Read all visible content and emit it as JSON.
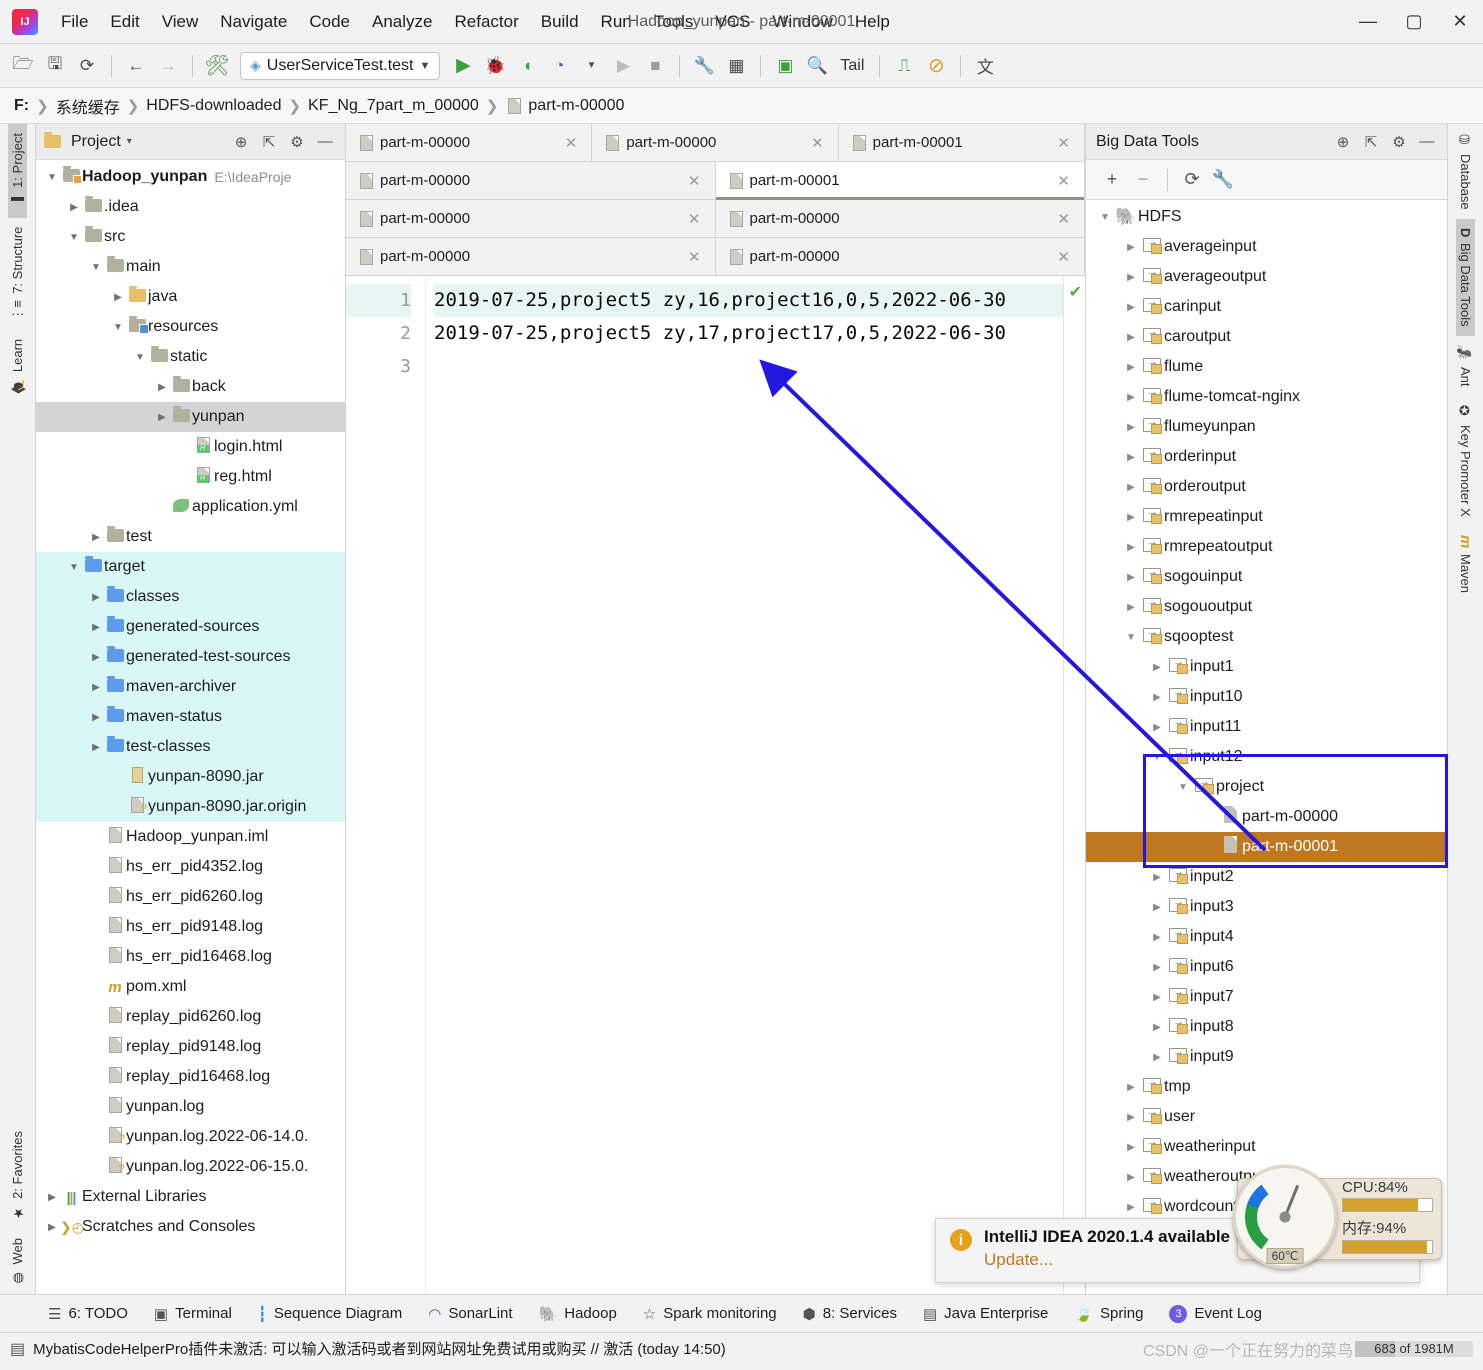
{
  "window": {
    "title": "Hadoop_yunpan - part-m-00001",
    "minimize": "—",
    "maximize": "▢",
    "close": "✕"
  },
  "menubar": {
    "items": [
      "File",
      "Edit",
      "View",
      "Navigate",
      "Code",
      "Analyze",
      "Refactor",
      "Build",
      "Run",
      "Tools",
      "VCS",
      "Window",
      "Help"
    ]
  },
  "toolbar": {
    "open_icon": "open-folder-icon",
    "save_icon": "save-icon",
    "sync_icon": "sync-icon",
    "back_icon": "←",
    "forward_icon": "→",
    "hammer_icon": "build-icon",
    "run_config": "UserServiceTest.test",
    "run_icon": "▶",
    "debug_icon": "debug-icon",
    "coverage_icon": "coverage-icon",
    "profile_icon": "profile-icon",
    "tail_label": "Tail",
    "search_icon": "🔍",
    "wrench_icon": "wrench-icon",
    "layout_icon": "layout-icon",
    "console_icon": "console-icon",
    "monitor_icon": "monitor-icon",
    "forbidden_icon": "⊘",
    "translate_icon": "translate-icon"
  },
  "breadcrumb": {
    "items": [
      "F:",
      "系统缓存",
      "HDFS-downloaded",
      "KF_Ng_7part_m_00000",
      "part-m-00000"
    ],
    "separator": "❯"
  },
  "left_strip": {
    "tabs": [
      {
        "label": "1: Project",
        "icon": "project-icon",
        "active": true
      },
      {
        "label": "7: Structure",
        "icon": "structure-icon",
        "active": false
      },
      {
        "label": "Learn",
        "icon": "graduation-cap-icon",
        "active": false
      }
    ],
    "bottom_tabs": [
      {
        "label": "2: Favorites",
        "icon": "star-icon"
      },
      {
        "label": "Web",
        "icon": "web-icon"
      }
    ]
  },
  "right_strip": {
    "tabs": [
      {
        "label": "Database",
        "icon": "database-icon",
        "active": false
      },
      {
        "label": "Big Data Tools",
        "icon": "big-data-icon",
        "active": true
      },
      {
        "label": "Ant",
        "icon": "ant-icon",
        "active": false
      },
      {
        "label": "Key Promoter X",
        "icon": "key-promoter-icon",
        "active": false
      },
      {
        "label": "Maven",
        "icon": "maven-icon",
        "active": false
      }
    ]
  },
  "project_panel": {
    "title": "Project",
    "title_caret": "▾",
    "icons": [
      "target-icon",
      "collapse-all-icon",
      "gear-icon",
      "hide-icon"
    ],
    "tree": [
      {
        "indent": 0,
        "arrow": "▼",
        "icon": "folder-src",
        "label": "Hadoop_yunpan",
        "bold": true,
        "suffix": "E:\\IdeaProje",
        "state": "none"
      },
      {
        "indent": 1,
        "arrow": "▶",
        "icon": "folder",
        "label": ".idea",
        "state": "none"
      },
      {
        "indent": 1,
        "arrow": "▼",
        "icon": "folder",
        "label": "src",
        "state": "none"
      },
      {
        "indent": 2,
        "arrow": "▼",
        "icon": "folder",
        "label": "main",
        "state": "none"
      },
      {
        "indent": 3,
        "arrow": "▶",
        "icon": "folder-yellow",
        "label": "java",
        "state": "none"
      },
      {
        "indent": 3,
        "arrow": "▼",
        "icon": "folder-res",
        "label": "resources",
        "state": "none"
      },
      {
        "indent": 4,
        "arrow": "▼",
        "icon": "folder",
        "label": "static",
        "state": "none"
      },
      {
        "indent": 5,
        "arrow": "▶",
        "icon": "folder",
        "label": "back",
        "state": "none"
      },
      {
        "indent": 5,
        "arrow": "▶",
        "icon": "folder",
        "label": "yunpan",
        "state": "sel-gray"
      },
      {
        "indent": 6,
        "arrow": "",
        "icon": "html-file",
        "label": "login.html",
        "state": "none"
      },
      {
        "indent": 6,
        "arrow": "",
        "icon": "html-file",
        "label": "reg.html",
        "state": "none"
      },
      {
        "indent": 5,
        "arrow": "",
        "icon": "yml-file",
        "label": "application.yml",
        "state": "none"
      },
      {
        "indent": 2,
        "arrow": "▶",
        "icon": "folder",
        "label": "test",
        "state": "none"
      },
      {
        "indent": 1,
        "arrow": "▼",
        "icon": "folder-blue",
        "label": "target",
        "state": "hl-cyan"
      },
      {
        "indent": 2,
        "arrow": "▶",
        "icon": "folder-blue",
        "label": "classes",
        "state": "hl-cyan"
      },
      {
        "indent": 2,
        "arrow": "▶",
        "icon": "folder-blue",
        "label": "generated-sources",
        "state": "hl-cyan"
      },
      {
        "indent": 2,
        "arrow": "▶",
        "icon": "folder-blue",
        "label": "generated-test-sources",
        "state": "hl-cyan"
      },
      {
        "indent": 2,
        "arrow": "▶",
        "icon": "folder-blue",
        "label": "maven-archiver",
        "state": "hl-cyan"
      },
      {
        "indent": 2,
        "arrow": "▶",
        "icon": "folder-blue",
        "label": "maven-status",
        "state": "hl-cyan"
      },
      {
        "indent": 2,
        "arrow": "▶",
        "icon": "folder-blue",
        "label": "test-classes",
        "state": "hl-cyan"
      },
      {
        "indent": 3,
        "arrow": "",
        "icon": "jar-file",
        "label": "yunpan-8090.jar",
        "state": "hl-cyan"
      },
      {
        "indent": 3,
        "arrow": "",
        "icon": "unknown-file",
        "label": "yunpan-8090.jar.origin",
        "state": "hl-cyan"
      },
      {
        "indent": 2,
        "arrow": "",
        "icon": "iml-file",
        "label": "Hadoop_yunpan.iml",
        "state": "none"
      },
      {
        "indent": 2,
        "arrow": "",
        "icon": "log-file",
        "label": "hs_err_pid4352.log",
        "state": "none"
      },
      {
        "indent": 2,
        "arrow": "",
        "icon": "log-file",
        "label": "hs_err_pid6260.log",
        "state": "none"
      },
      {
        "indent": 2,
        "arrow": "",
        "icon": "log-file",
        "label": "hs_err_pid9148.log",
        "state": "none"
      },
      {
        "indent": 2,
        "arrow": "",
        "icon": "log-file",
        "label": "hs_err_pid16468.log",
        "state": "none"
      },
      {
        "indent": 2,
        "arrow": "",
        "icon": "maven-file",
        "label": "pom.xml",
        "state": "none"
      },
      {
        "indent": 2,
        "arrow": "",
        "icon": "log-file",
        "label": "replay_pid6260.log",
        "state": "none"
      },
      {
        "indent": 2,
        "arrow": "",
        "icon": "log-file",
        "label": "replay_pid9148.log",
        "state": "none"
      },
      {
        "indent": 2,
        "arrow": "",
        "icon": "log-file",
        "label": "replay_pid16468.log",
        "state": "none"
      },
      {
        "indent": 2,
        "arrow": "",
        "icon": "log-file",
        "label": "yunpan.log",
        "state": "none"
      },
      {
        "indent": 2,
        "arrow": "",
        "icon": "unknown-file",
        "label": "yunpan.log.2022-06-14.0.",
        "state": "none"
      },
      {
        "indent": 2,
        "arrow": "",
        "icon": "unknown-file",
        "label": "yunpan.log.2022-06-15.0.",
        "state": "none"
      },
      {
        "indent": 0,
        "arrow": "▶",
        "icon": "library-icon",
        "label": "External Libraries",
        "state": "none"
      },
      {
        "indent": 0,
        "arrow": "▶",
        "icon": "scratch-icon",
        "label": "Scratches and Consoles",
        "state": "none"
      }
    ]
  },
  "editor": {
    "tab_rows": [
      [
        {
          "label": "part-m-00000",
          "active": false,
          "close": "✕"
        },
        {
          "label": "part-m-00000",
          "active": false,
          "close": "✕"
        },
        {
          "label": "part-m-00001",
          "active": false,
          "close": "✕"
        }
      ],
      [
        {
          "label": "part-m-00000",
          "active": false,
          "close": "✕"
        },
        {
          "label": "part-m-00001",
          "active": true,
          "close": "✕"
        }
      ],
      [
        {
          "label": "part-m-00000",
          "active": false,
          "close": "✕"
        },
        {
          "label": "part-m-00000",
          "active": false,
          "close": "✕"
        }
      ],
      [
        {
          "label": "part-m-00000",
          "active": false,
          "close": "✕"
        },
        {
          "label": "part-m-00000",
          "active": false,
          "close": "✕"
        }
      ]
    ],
    "line_numbers": [
      "1",
      "2",
      "3"
    ],
    "lines": [
      "2019-07-25,project5 zy,16,project16,0,5,2022-06-30",
      "2019-07-25,project5 zy,17,project17,0,5,2022-06-30",
      ""
    ],
    "inspection_mark": "✔"
  },
  "big_data_tools": {
    "title": "Big Data Tools",
    "header_icons": [
      "target-icon",
      "collapse-all-icon",
      "gear-icon",
      "hide-icon"
    ],
    "toolbar_icons": [
      "add-icon",
      "remove-icon",
      "refresh-icon",
      "wrench-icon"
    ],
    "tree": [
      {
        "indent": 0,
        "arrow": "▼",
        "icon": "hadoop-icon",
        "label": "HDFS",
        "state": "none"
      },
      {
        "indent": 1,
        "arrow": "▶",
        "icon": "hdfs-folder",
        "label": "averageinput",
        "state": "none"
      },
      {
        "indent": 1,
        "arrow": "▶",
        "icon": "hdfs-folder",
        "label": "averageoutput",
        "state": "none"
      },
      {
        "indent": 1,
        "arrow": "▶",
        "icon": "hdfs-folder",
        "label": "carinput",
        "state": "none"
      },
      {
        "indent": 1,
        "arrow": "▶",
        "icon": "hdfs-folder",
        "label": "caroutput",
        "state": "none"
      },
      {
        "indent": 1,
        "arrow": "▶",
        "icon": "hdfs-folder",
        "label": "flume",
        "state": "none"
      },
      {
        "indent": 1,
        "arrow": "▶",
        "icon": "hdfs-folder",
        "label": "flume-tomcat-nginx",
        "state": "none"
      },
      {
        "indent": 1,
        "arrow": "▶",
        "icon": "hdfs-folder",
        "label": "flumeyunpan",
        "state": "none"
      },
      {
        "indent": 1,
        "arrow": "▶",
        "icon": "hdfs-folder",
        "label": "orderinput",
        "state": "none"
      },
      {
        "indent": 1,
        "arrow": "▶",
        "icon": "hdfs-folder",
        "label": "orderoutput",
        "state": "none"
      },
      {
        "indent": 1,
        "arrow": "▶",
        "icon": "hdfs-folder",
        "label": "rmrepeatinput",
        "state": "none"
      },
      {
        "indent": 1,
        "arrow": "▶",
        "icon": "hdfs-folder",
        "label": "rmrepeatoutput",
        "state": "none"
      },
      {
        "indent": 1,
        "arrow": "▶",
        "icon": "hdfs-folder",
        "label": "sogouinput",
        "state": "none"
      },
      {
        "indent": 1,
        "arrow": "▶",
        "icon": "hdfs-folder",
        "label": "sogououtput",
        "state": "none"
      },
      {
        "indent": 1,
        "arrow": "▼",
        "icon": "hdfs-folder",
        "label": "sqooptest",
        "state": "none"
      },
      {
        "indent": 2,
        "arrow": "▶",
        "icon": "hdfs-folder",
        "label": "input1",
        "state": "none"
      },
      {
        "indent": 2,
        "arrow": "▶",
        "icon": "hdfs-folder",
        "label": "input10",
        "state": "none"
      },
      {
        "indent": 2,
        "arrow": "▶",
        "icon": "hdfs-folder",
        "label": "input11",
        "state": "none"
      },
      {
        "indent": 2,
        "arrow": "▼",
        "icon": "hdfs-folder",
        "label": "input12",
        "state": "none"
      },
      {
        "indent": 3,
        "arrow": "▼",
        "icon": "hdfs-folder",
        "label": "project",
        "state": "none"
      },
      {
        "indent": 4,
        "arrow": "",
        "icon": "plain-file",
        "label": "part-m-00000",
        "state": "none"
      },
      {
        "indent": 4,
        "arrow": "",
        "icon": "plain-file",
        "label": "part-m-00001",
        "state": "selected"
      },
      {
        "indent": 2,
        "arrow": "▶",
        "icon": "hdfs-folder",
        "label": "input2",
        "state": "none"
      },
      {
        "indent": 2,
        "arrow": "▶",
        "icon": "hdfs-folder",
        "label": "input3",
        "state": "none"
      },
      {
        "indent": 2,
        "arrow": "▶",
        "icon": "hdfs-folder",
        "label": "input4",
        "state": "none"
      },
      {
        "indent": 2,
        "arrow": "▶",
        "icon": "hdfs-folder",
        "label": "input6",
        "state": "none"
      },
      {
        "indent": 2,
        "arrow": "▶",
        "icon": "hdfs-folder",
        "label": "input7",
        "state": "none"
      },
      {
        "indent": 2,
        "arrow": "▶",
        "icon": "hdfs-folder",
        "label": "input8",
        "state": "none"
      },
      {
        "indent": 2,
        "arrow": "▶",
        "icon": "hdfs-folder",
        "label": "input9",
        "state": "none"
      },
      {
        "indent": 1,
        "arrow": "▶",
        "icon": "hdfs-folder",
        "label": "tmp",
        "state": "none"
      },
      {
        "indent": 1,
        "arrow": "▶",
        "icon": "hdfs-folder",
        "label": "user",
        "state": "none"
      },
      {
        "indent": 1,
        "arrow": "▶",
        "icon": "hdfs-folder",
        "label": "weatherinput",
        "state": "none"
      },
      {
        "indent": 1,
        "arrow": "▶",
        "icon": "hdfs-folder",
        "label": "weatheroutput",
        "state": "none"
      },
      {
        "indent": 1,
        "arrow": "▶",
        "icon": "hdfs-folder",
        "label": "wordcount",
        "state": "none"
      }
    ]
  },
  "annotation": {
    "highlight_color": "#2418e0",
    "selection_color": "#c07820"
  },
  "notification": {
    "icon": "info-icon",
    "title": "IntelliJ IDEA 2020.1.4 available",
    "link": "Update..."
  },
  "cpu_widget": {
    "cpu_label": "CPU:84%",
    "cpu_percent": 84,
    "mem_label": "内存:94%",
    "mem_percent": 94,
    "temperature": "60℃"
  },
  "bottom_bar": {
    "items": [
      {
        "label": "6: TODO",
        "icon": "todo-icon"
      },
      {
        "label": "Terminal",
        "icon": "terminal-icon"
      },
      {
        "label": "Sequence Diagram",
        "icon": "sequence-diagram-icon"
      },
      {
        "label": "SonarLint",
        "icon": "sonarlint-icon"
      },
      {
        "label": "Hadoop",
        "icon": "hadoop-icon"
      },
      {
        "label": "Spark monitoring",
        "icon": "star-icon"
      },
      {
        "label": "8: Services",
        "icon": "services-icon"
      },
      {
        "label": "Java Enterprise",
        "icon": "java-enterprise-icon"
      },
      {
        "label": "Spring",
        "icon": "spring-icon"
      },
      {
        "label": "Event Log",
        "icon": "event-log-icon",
        "badge": "3"
      }
    ]
  },
  "status_bar": {
    "icon": "note-icon",
    "message": "MybatisCodeHelperPro插件未激活: 可以输入激活码或者到网站网址免费试用或购买 // 激活 (today 14:50)",
    "watermark": "CSDN @一个正在努力的菜鸟",
    "memory": "683 of 1981M"
  }
}
